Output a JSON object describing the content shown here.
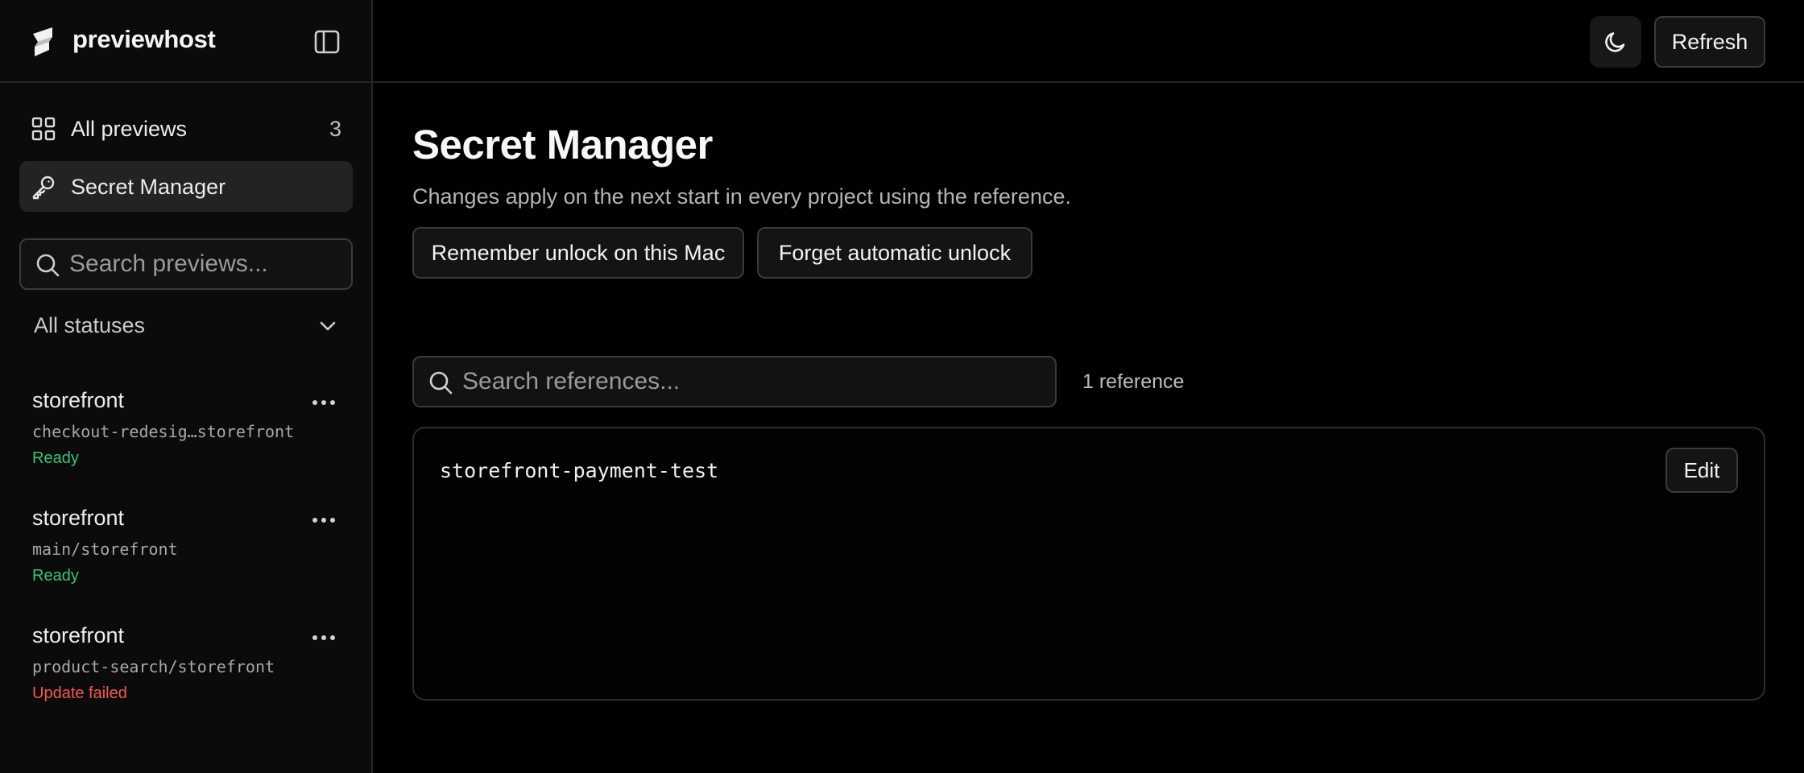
{
  "app": {
    "name": "previewhost"
  },
  "sidebar": {
    "nav": [
      {
        "label": "All previews",
        "count": "3"
      },
      {
        "label": "Secret Manager"
      }
    ],
    "search": {
      "placeholder": "Search previews..."
    },
    "status_filter": {
      "selected": "All statuses"
    },
    "previews": [
      {
        "name": "storefront",
        "branch": "checkout-redesig…storefront",
        "status": "Ready",
        "status_color": "#34c57a"
      },
      {
        "name": "storefront",
        "branch": "main/storefront",
        "status": "Ready",
        "status_color": "#34c57a"
      },
      {
        "name": "storefront",
        "branch": "product-search/storefront",
        "status": "Update failed",
        "status_color": "#f4574d"
      }
    ]
  },
  "header": {
    "theme_icon": "moon-icon",
    "refresh_label": "Refresh"
  },
  "main": {
    "title": "Secret Manager",
    "subtitle": "Changes apply on the next start in every project using the reference.",
    "actions": {
      "remember_label": "Remember unlock on this Mac",
      "forget_label": "Forget automatic unlock"
    },
    "search": {
      "placeholder": "Search references..."
    },
    "reference_count": "1 reference",
    "references": [
      {
        "name": "storefront-payment-test",
        "edit_label": "Edit"
      }
    ]
  },
  "colors": {
    "background": "#000000",
    "sidebar": "#0b0b0b",
    "border": "#262626",
    "ready": "#34c57a",
    "failed": "#f4574d"
  }
}
